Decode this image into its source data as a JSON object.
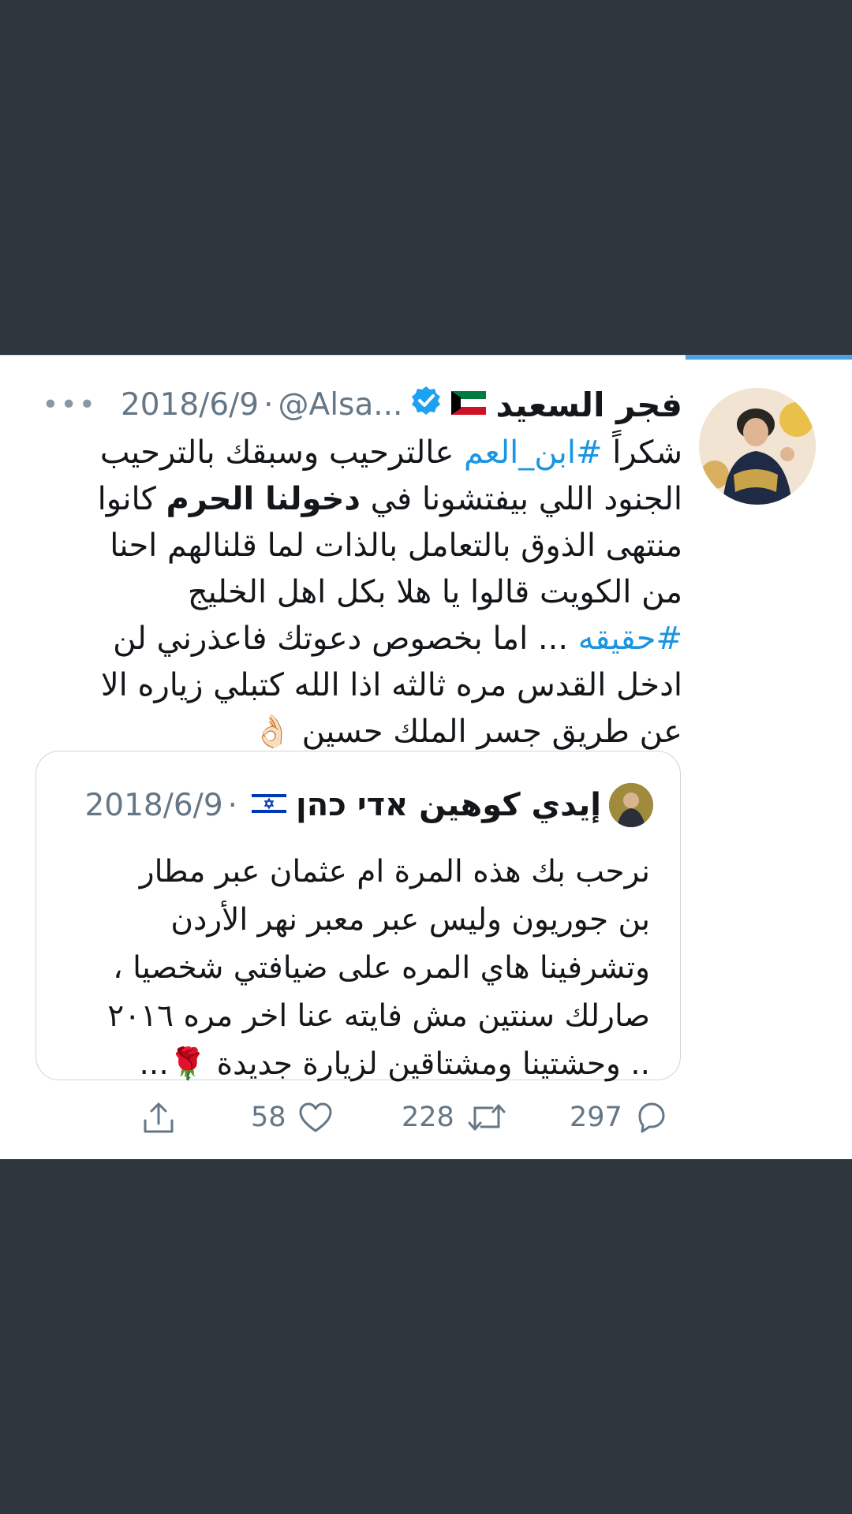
{
  "tweet": {
    "name": "فجر السعيد",
    "flag_icon": "kuwait-flag-icon",
    "handle": "@Alsa...",
    "date": "2018/6/9",
    "dot": "·",
    "more": "•••",
    "body": {
      "line1_a": "شكراً ",
      "line1_tag": "#ابن_العم",
      "line1_b": " عالترحيب وسبقك بالترحيب",
      "line2_a": "الجنود اللي بيفتشونا في ",
      "line2_bold": "دخولنا الحرم",
      "line2_b": " كانوا",
      "line3": "منتهى الذوق بالتعامل بالذات لما قلنالهم احنا",
      "line4": "من الكويت قالوا يا هلا بكل اهل الخليج",
      "line5_tag": "#حقيقه",
      "line5_b": " ... اما بخصوص دعوتك فاعذرني لن",
      "line6": "ادخل القدس مره ثالثه اذا الله كتبلي زياره الا",
      "line7": "عن طريق جسر الملك حسين 👌🏻"
    }
  },
  "quote": {
    "name": "إيدي كوهين אדי כהן",
    "flag_icon": "israel-flag-icon",
    "date": "2018/6/9",
    "dot": "·",
    "lines": [
      "نرحب بك هذه المرة ام عثمان عبر مطار",
      "بن جوريون وليس عبر معبر نهر الأردن",
      "وتشرفينا هاي المره على ضيافتي شخصيا ،",
      "صارلك سنتين مش فايته عنا اخر مره ٢٠١٦",
      ".. وحشتينا ومشتاقين لزيارة جديدة 🌹..."
    ]
  },
  "actions": {
    "replies": "297",
    "retweets": "228",
    "likes": "58"
  },
  "colors": {
    "background": "#2e363e",
    "card": "#ffffff",
    "link": "#1b95e0",
    "muted": "#657786",
    "accent_bar": "#4aa3df"
  }
}
